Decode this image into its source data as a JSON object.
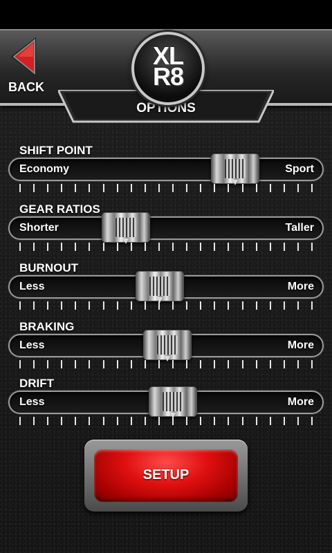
{
  "header": {
    "back_label": "BACK",
    "logo_line1": "XL",
    "logo_line2": "R8",
    "page_title": "OPTIONS"
  },
  "sliders": [
    {
      "title": "SHIFT POINT",
      "min_label": "Economy",
      "max_label": "Sport",
      "value": 0.76
    },
    {
      "title": "GEAR RATIOS",
      "min_label": "Shorter",
      "max_label": "Taller",
      "value": 0.34
    },
    {
      "title": "BURNOUT",
      "min_label": "Less",
      "max_label": "More",
      "value": 0.47
    },
    {
      "title": "BRAKING",
      "min_label": "Less",
      "max_label": "More",
      "value": 0.5
    },
    {
      "title": "DRIFT",
      "min_label": "Less",
      "max_label": "More",
      "value": 0.52
    }
  ],
  "setup_button": {
    "label": "SETUP"
  },
  "colors": {
    "accent": "#e01010",
    "text": "#ffffff",
    "back_arrow": "#d42020"
  }
}
